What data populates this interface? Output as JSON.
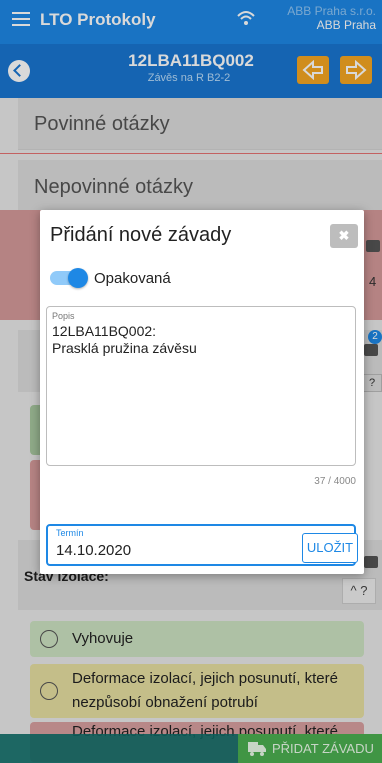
{
  "header": {
    "app_title": "LTO Protokoly",
    "company_line1": "ABB Praha s.r.o.",
    "company_line2": "ABB Praha"
  },
  "subheader": {
    "code": "12LBA11BQ002",
    "subtitle": "Závěs na R B2-2"
  },
  "sections": {
    "mandatory": "Povinné otázky",
    "optional": "Nepovinné otázky"
  },
  "background": {
    "badge_count": "2",
    "pink_count": "4",
    "question_mark": "?",
    "stav_title": "Stav izolace:",
    "help_label": "^ ?"
  },
  "options": [
    {
      "text": "Vyhovuje"
    },
    {
      "text": "Deformace izolací, jejich posunutí, které nezpůsobí obnažení potrubí"
    },
    {
      "text": "Deformace izolací, jejich posunutí, které"
    }
  ],
  "footer": {
    "add_defect": "PŘIDAT ZÁVADU"
  },
  "modal": {
    "title": "Přidání nové závady",
    "close_label": "✖",
    "toggle_label": "Opakovaná",
    "toggle_on": true,
    "description_label": "Popis",
    "description_value": "12LBA11BQ002:\nPrasklá pružina závěsu",
    "counter": "37 / 4000",
    "date_label": "Termín",
    "date_value": "14.10.2020",
    "save_label": "ULOŽIT"
  },
  "colors": {
    "primary": "#1e88e5",
    "header_dark": "#1976d2",
    "accent_orange": "#f5a623",
    "success": "#4caf50"
  }
}
